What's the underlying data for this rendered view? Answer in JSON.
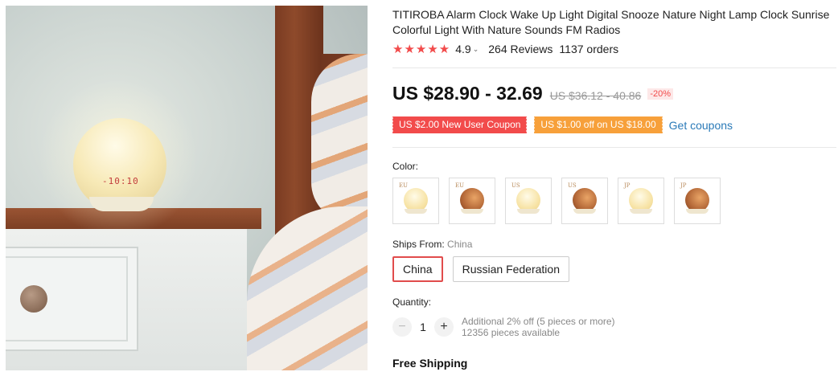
{
  "product": {
    "title": "TITIROBA Alarm Clock Wake Up Light Digital Snooze Nature Night Lamp Clock Sunrise Colorful Light With Nature Sounds FM Radios",
    "image_clock_display": "-10:10"
  },
  "rating": {
    "stars": "★★★★★",
    "value": "4.9",
    "chevron": "⌄",
    "reviews": "264 Reviews",
    "orders": "1137 orders"
  },
  "price": {
    "current": "US $28.90 - 32.69",
    "original": "US $36.12 - 40.86",
    "discount": "-20%"
  },
  "coupons": {
    "new_user": "US $2.00 New User Coupon",
    "store": "US $1.00 off on US $18.00",
    "get_link": "Get coupons"
  },
  "color": {
    "label": "Color:",
    "options": [
      {
        "tag": "EU",
        "style": "light"
      },
      {
        "tag": "EU",
        "style": "wood"
      },
      {
        "tag": "US",
        "style": "light"
      },
      {
        "tag": "US",
        "style": "wood"
      },
      {
        "tag": "JP",
        "style": "light"
      },
      {
        "tag": "JP",
        "style": "wood"
      }
    ]
  },
  "ships_from": {
    "label": "Ships From:",
    "selected_value": "China",
    "options": [
      "China",
      "Russian Federation"
    ]
  },
  "quantity": {
    "label": "Quantity:",
    "minus": "−",
    "value": "1",
    "plus": "+",
    "bulk_note": "Additional 2% off (5 pieces or more)",
    "available": "12356 pieces available"
  },
  "shipping": {
    "label": "Free Shipping"
  },
  "colors": {
    "accent_red": "#f24b4b",
    "coupon_orange": "#f7a03a",
    "link_blue": "#2a7ab8"
  }
}
